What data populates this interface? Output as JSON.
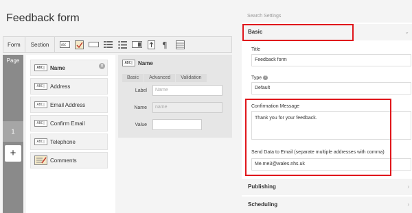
{
  "app": {
    "title": "Feedback form"
  },
  "toolbar": {
    "form_label": "Form",
    "section_label": "Section",
    "icons": [
      "text-field-icon",
      "checkbox-field-icon",
      "line-field-icon",
      "list-field-icon",
      "list-alt-icon",
      "toggle-field-icon",
      "upload-icon",
      "paragraph-icon",
      "table-icon"
    ]
  },
  "pages": {
    "label": "Page",
    "items": [
      "1"
    ],
    "add_label": "+"
  },
  "fields": [
    {
      "label": "Name",
      "icon_text": "ABC|"
    },
    {
      "label": "Address",
      "icon_text": "ABC|"
    },
    {
      "label": "Email Address",
      "icon_text": "ABC|"
    },
    {
      "label": "Confirm Email",
      "icon_text": "ABC|"
    },
    {
      "label": "Telephone",
      "icon_text": "ABC|"
    },
    {
      "label": "Comments",
      "icon_text": ""
    }
  ],
  "editor": {
    "title": "Name",
    "icon_text": "ABC|",
    "tabs": [
      "Basic",
      "Advanced",
      "Validation"
    ],
    "rows": [
      {
        "label": "Label",
        "placeholder": "Name"
      },
      {
        "label": "Name",
        "placeholder": "name"
      },
      {
        "label": "Value",
        "placeholder": ""
      }
    ]
  },
  "settings": {
    "search_placeholder": "Search Settings",
    "basic_label": "Basic",
    "title_label": "Title",
    "title_value": "Feedback form",
    "type_label": "Type",
    "type_value": "Default",
    "confirmation_label": "Confirmation Message",
    "confirmation_value": "Thank you for your feedback.",
    "send_label": "Send Data to Email (separate multiple addresses with comma)",
    "send_value": "Me.me3@wales.nhs.uk",
    "publishing_label": "Publishing",
    "scheduling_label": "Scheduling"
  },
  "colors": {
    "highlight": "#e0161b",
    "page_column": "#8a8a8a"
  }
}
